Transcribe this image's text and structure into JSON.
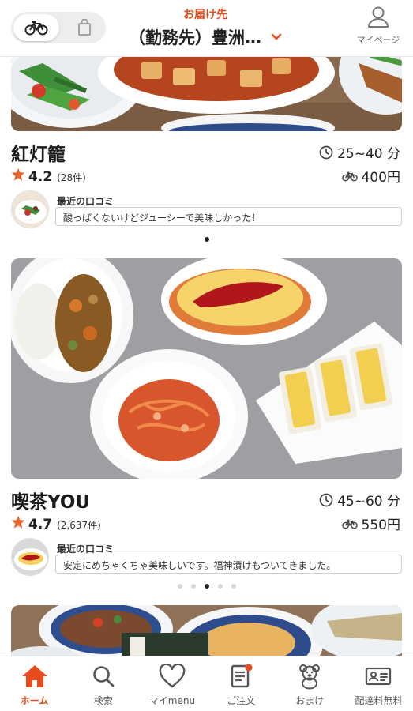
{
  "header": {
    "deliver_label": "お届け先",
    "address": "（勤務先）豊洲…",
    "mypage_label": "マイページ"
  },
  "restaurants": [
    {
      "name": "紅灯籠",
      "rating": "4.2",
      "review_count": "(28件)",
      "eta": "25~40 分",
      "fee": "400円",
      "review_title": "最近の口コミ",
      "review_text": "酸っぱくないけどジューシーで美味しかった！",
      "carousel_total": 1,
      "carousel_index": 0
    },
    {
      "name": "喫茶YOU",
      "rating": "4.7",
      "review_count": "(2,637件)",
      "eta": "45~60 分",
      "fee": "550円",
      "review_title": "最近の口コミ",
      "review_text": "安定にめちゃくちゃ美味しいです。福神漬けもついてきました。",
      "carousel_total": 5,
      "carousel_index": 2
    }
  ],
  "nav": [
    {
      "label": "ホーム",
      "icon": "home-icon",
      "active": true
    },
    {
      "label": "検索",
      "icon": "search-icon",
      "active": false
    },
    {
      "label": "マイmenu",
      "icon": "heart-icon",
      "active": false
    },
    {
      "label": "ご注文",
      "icon": "order-icon",
      "active": false,
      "badge": true
    },
    {
      "label": "おまけ",
      "icon": "bear-icon",
      "active": false
    },
    {
      "label": "配達料無料",
      "icon": "pass-card-icon",
      "active": false
    }
  ],
  "colors": {
    "accent": "#e84c1c",
    "star": "#e8622c",
    "text": "#222222"
  }
}
